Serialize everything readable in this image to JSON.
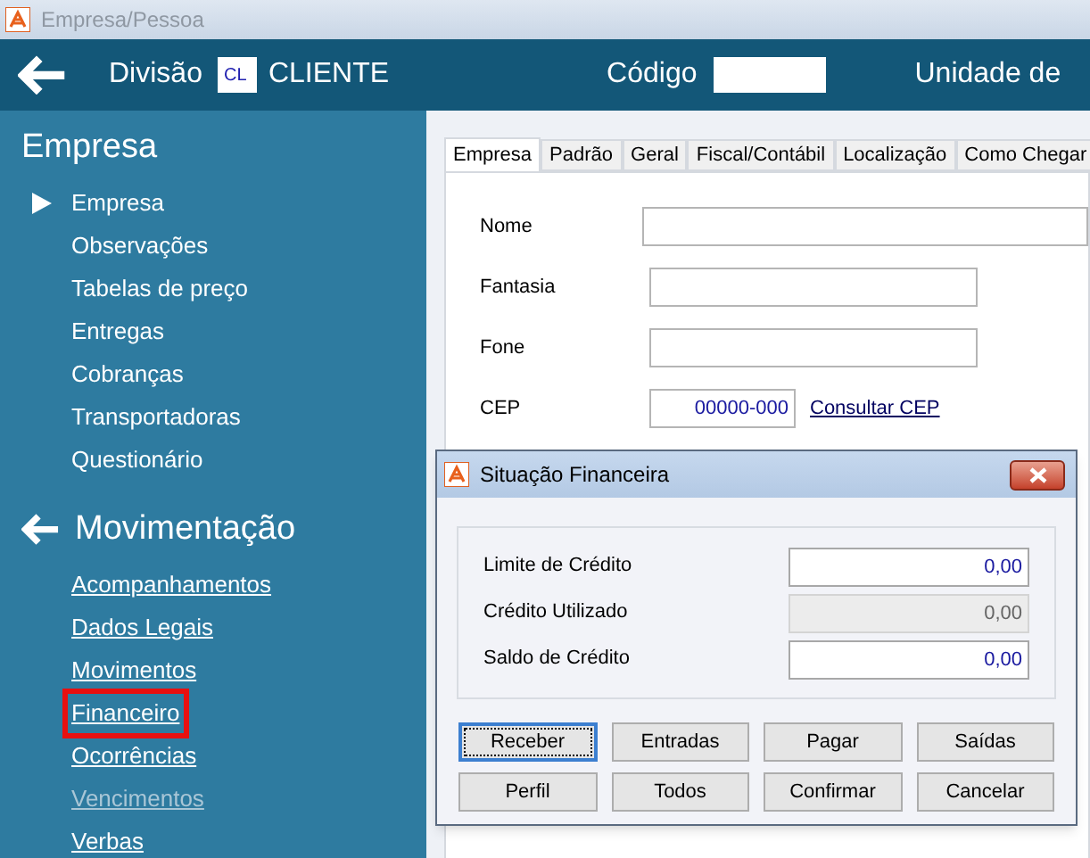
{
  "window": {
    "title": "Empresa/Pessoa"
  },
  "header": {
    "division_label": "Divisão",
    "division_code": "CL",
    "division_name": "CLIENTE",
    "code_label": "Código",
    "unit_label": "Unidade de"
  },
  "sidebar": {
    "sections": [
      {
        "title": "Empresa",
        "kind": "plain",
        "items": [
          {
            "label": "Empresa",
            "selected": true,
            "disabled": false,
            "highlighted": false
          },
          {
            "label": "Observações",
            "selected": false,
            "disabled": false,
            "highlighted": false
          },
          {
            "label": "Tabelas de preço",
            "selected": false,
            "disabled": false,
            "highlighted": false
          },
          {
            "label": "Entregas",
            "selected": false,
            "disabled": false,
            "highlighted": false
          },
          {
            "label": "Cobranças",
            "selected": false,
            "disabled": false,
            "highlighted": false
          },
          {
            "label": "Transportadoras",
            "selected": false,
            "disabled": false,
            "highlighted": false
          },
          {
            "label": "Questionário",
            "selected": false,
            "disabled": false,
            "highlighted": false
          }
        ]
      },
      {
        "title": "Movimentação",
        "kind": "links",
        "items": [
          {
            "label": "Acompanhamentos",
            "selected": false,
            "disabled": false,
            "highlighted": false
          },
          {
            "label": "Dados Legais",
            "selected": false,
            "disabled": false,
            "highlighted": false
          },
          {
            "label": "Movimentos",
            "selected": false,
            "disabled": false,
            "highlighted": false
          },
          {
            "label": "Financeiro",
            "selected": false,
            "disabled": false,
            "highlighted": true
          },
          {
            "label": "Ocorrências",
            "selected": false,
            "disabled": false,
            "highlighted": false
          },
          {
            "label": "Vencimentos",
            "selected": false,
            "disabled": true,
            "highlighted": false
          },
          {
            "label": "Verbas",
            "selected": false,
            "disabled": false,
            "highlighted": false
          }
        ]
      }
    ]
  },
  "tabs": [
    {
      "label": "Empresa",
      "selected": true
    },
    {
      "label": "Padrão",
      "selected": false
    },
    {
      "label": "Geral",
      "selected": false
    },
    {
      "label": "Fiscal/Contábil",
      "selected": false
    },
    {
      "label": "Localização",
      "selected": false
    },
    {
      "label": "Como Chegar",
      "selected": false
    }
  ],
  "form": {
    "fields": [
      {
        "label": "Nome"
      },
      {
        "label": "Fantasia"
      },
      {
        "label": "Fone"
      },
      {
        "label": "CEP",
        "value": "00000-000",
        "link": "Consultar CEP"
      }
    ]
  },
  "dialog": {
    "title": "Situação Financeira",
    "fields": [
      {
        "label": "Limite de Crédito",
        "value": "0,00",
        "disabled": false
      },
      {
        "label": "Crédito Utilizado",
        "value": "0,00",
        "disabled": true
      },
      {
        "label": "Saldo de Crédito",
        "value": "0,00",
        "disabled": false
      }
    ],
    "buttons": [
      {
        "label": "Receber",
        "focused": true
      },
      {
        "label": "Entradas",
        "focused": false
      },
      {
        "label": "Pagar",
        "focused": false
      },
      {
        "label": "Saídas",
        "focused": false
      },
      {
        "label": "Perfil",
        "focused": false
      },
      {
        "label": "Todos",
        "focused": false
      },
      {
        "label": "Confirmar",
        "focused": false
      },
      {
        "label": "Cancelar",
        "focused": false
      }
    ]
  }
}
